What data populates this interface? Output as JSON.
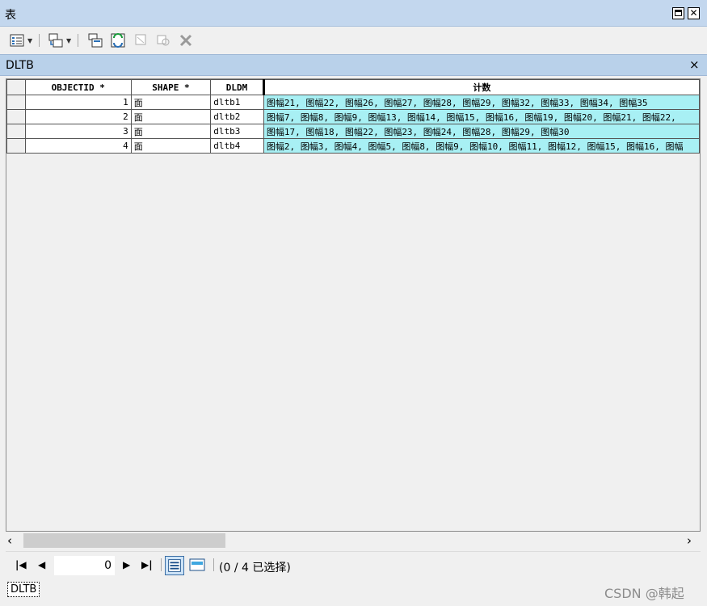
{
  "window": {
    "title": "表"
  },
  "tab": {
    "label": "DLTB",
    "close_icon": "×"
  },
  "table": {
    "columns": [
      "OBJECTID *",
      "SHAPE *",
      "DLDM",
      "计数"
    ],
    "rows": [
      {
        "objectid": "1",
        "shape": "面",
        "dldm": "dltb1",
        "count": "图幅21, 图幅22, 图幅26, 图幅27, 图幅28, 图幅29, 图幅32, 图幅33, 图幅34, 图幅35"
      },
      {
        "objectid": "2",
        "shape": "面",
        "dldm": "dltb2",
        "count": "图幅7, 图幅8, 图幅9, 图幅13, 图幅14, 图幅15, 图幅16, 图幅19, 图幅20, 图幅21, 图幅22,"
      },
      {
        "objectid": "3",
        "shape": "面",
        "dldm": "dltb3",
        "count": "图幅17, 图幅18, 图幅22, 图幅23, 图幅24, 图幅28, 图幅29, 图幅30"
      },
      {
        "objectid": "4",
        "shape": "面",
        "dldm": "dltb4",
        "count": "图幅2, 图幅3, 图幅4, 图幅5, 图幅8, 图幅9, 图幅10, 图幅11, 图幅12, 图幅15, 图幅16, 图幅"
      }
    ]
  },
  "navigation": {
    "current_record": "0",
    "selection_status": "(0 / 4 已选择)"
  },
  "bottom": {
    "layer_tab": "DLTB",
    "watermark": "CSDN @韩起"
  },
  "colors": {
    "selected_column": "#a8f0f4",
    "titlebar": "#c3d7ee",
    "tabstrip": "#b9d1ea"
  }
}
